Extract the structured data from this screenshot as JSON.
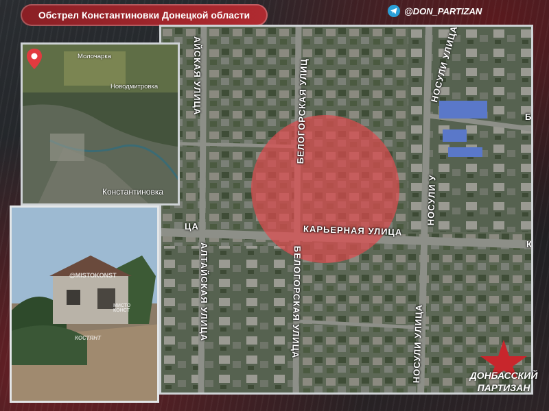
{
  "header": {
    "title": "Обстрел Константиновки Донецкой области",
    "telegram_handle": "@DON_PARTIZAN"
  },
  "main_map": {
    "streets": {
      "altai_top": "АЙСКАЯ УЛИЦА",
      "belogorsk_top": "БЕЛОГОРСКАЯ УЛИЦ",
      "nosuli_top": "НОСУЛИ УЛИЦА",
      "nosuli_top_right": "НОСУЛИ У",
      "karyernaya": "КАРЬЕРНАЯ УЛИЦА",
      "left_fragment": "ЦА",
      "right_fragment_b": "Б",
      "right_fragment_k": "К",
      "altai_bottom": "АЛТАЙСКАЯ УЛИЦА",
      "belogorsk_bottom": "БЕЛОГОРСКАЯ УЛИЦА",
      "nosuli_bottom": "НОСУЛИ УЛИЦА"
    },
    "strike_zone_color": "#e04a4f"
  },
  "inset_map": {
    "labels": {
      "molochar": "Молочарка",
      "novodmitrovka": "Новодмитровка",
      "konstantinovka": "Константиновка"
    },
    "pin_color": "#e23a3f"
  },
  "photo": {
    "watermark": "@MISTOKONST",
    "watermark_2": "МИСТО КОНСТ",
    "watermark_3": "КОСТЯНТ"
  },
  "logo": {
    "line1": "ДОНБАССКИЙ",
    "line2": "ПАРТИЗАН",
    "star_color": "#c8262c"
  }
}
